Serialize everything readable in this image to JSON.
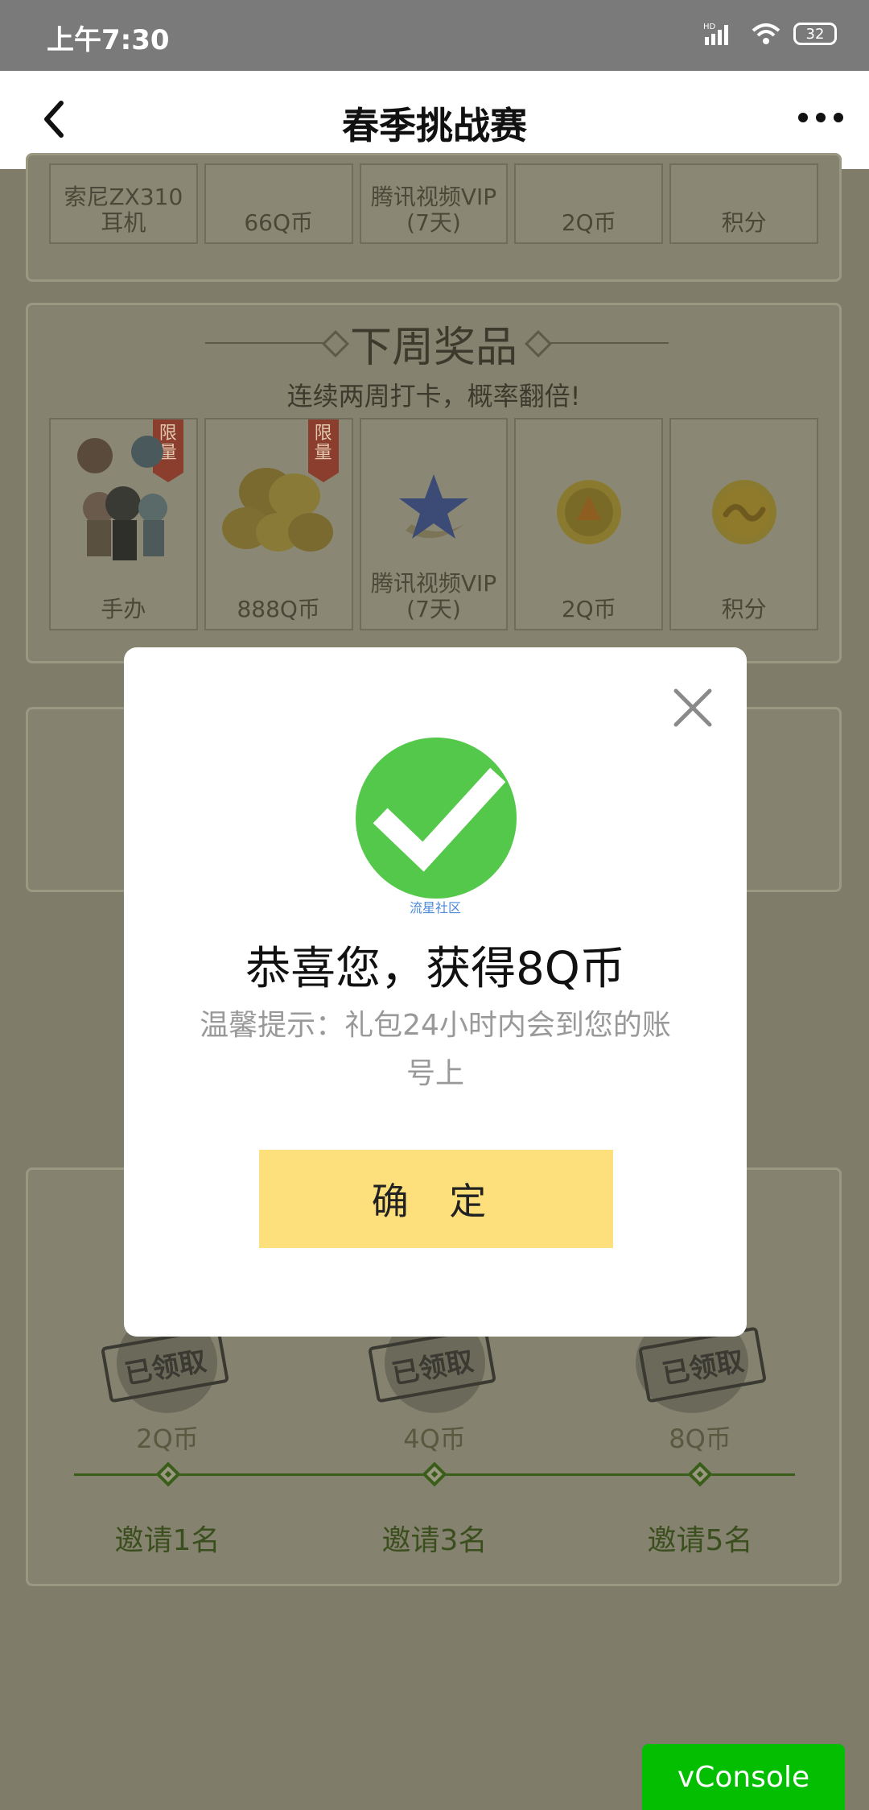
{
  "status_bar": {
    "time": "上午7:30",
    "network": "HD",
    "battery": "32"
  },
  "nav": {
    "title": "春季挑战赛"
  },
  "this_week": {
    "prizes": [
      {
        "label_line1": "索尼ZX310",
        "label_line2": "耳机"
      },
      {
        "label_line1": "66Q币",
        "label_line2": ""
      },
      {
        "label_line1": "腾讯视频VIP",
        "label_line2": "(7天)"
      },
      {
        "label_line1": "2Q币",
        "label_line2": ""
      },
      {
        "label_line1": "积分",
        "label_line2": ""
      }
    ]
  },
  "next_week": {
    "title": "下周奖品",
    "subtitle": "连续两周打卡，概率翻倍!",
    "tag_text": "限量",
    "prizes": [
      {
        "label_line1": "手办",
        "label_line2": "",
        "limited": true,
        "icon": "figurine-icon"
      },
      {
        "label_line1": "888Q币",
        "label_line2": "",
        "limited": true,
        "icon": "gold-coins-icon"
      },
      {
        "label_line1": "腾讯视频VIP",
        "label_line2": "(7天)",
        "limited": false,
        "icon": "star-icon"
      },
      {
        "label_line1": "2Q币",
        "label_line2": "",
        "limited": false,
        "icon": "coin-icon"
      },
      {
        "label_line1": "积分",
        "label_line2": "",
        "limited": false,
        "icon": "points-icon"
      }
    ]
  },
  "invite": {
    "stamp_text": "已领取",
    "rewards": [
      {
        "amount": "2Q币",
        "requirement": "邀请1名"
      },
      {
        "amount": "4Q币",
        "requirement": "邀请3名"
      },
      {
        "amount": "8Q币",
        "requirement": "邀请5名"
      }
    ]
  },
  "modal": {
    "watermark": "流星社区",
    "headline": "恭喜您，获得8Q币",
    "hint": "温馨提示：礼包24小时内会到您的账号上",
    "confirm_label": "确 定"
  },
  "vconsole": {
    "label": "vConsole"
  },
  "colors": {
    "success_green": "#54c84a",
    "confirm_yellow": "#fde07c",
    "vconsole_green": "#04be02"
  }
}
